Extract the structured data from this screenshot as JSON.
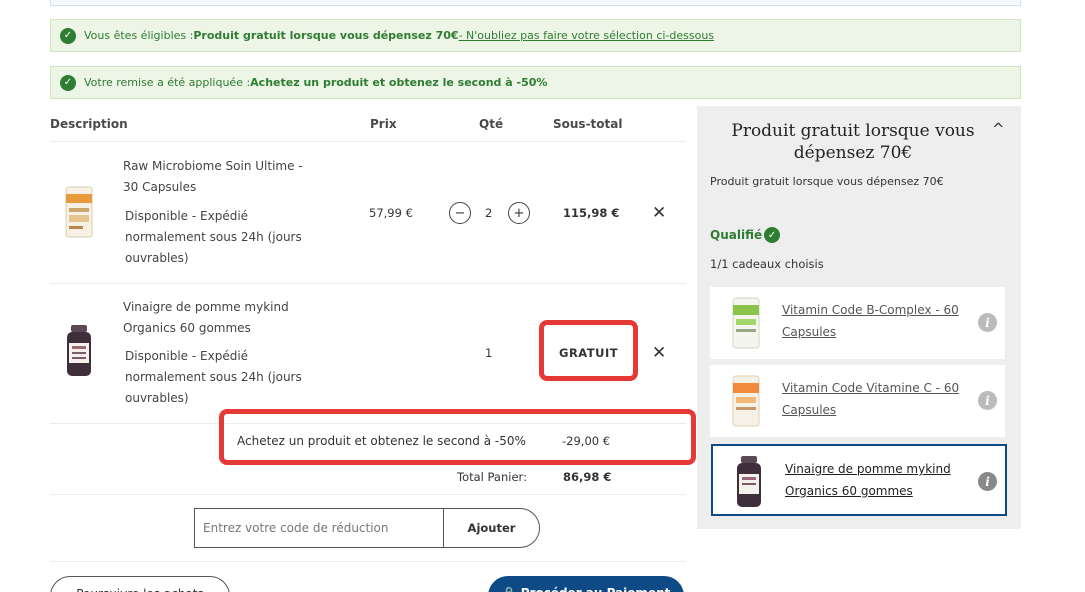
{
  "notices": [
    {
      "prefix": "Vous êtes éligibles : ",
      "bold": "Produit gratuit lorsque vous dépensez 70€",
      "link": " - N'oubliez pas faire votre sélection ci-dessous"
    },
    {
      "prefix": "Votre remise a été appliquée : ",
      "bold": "Achetez un produit et obtenez le second à -50%",
      "link": ""
    }
  ],
  "table": {
    "headers": {
      "description": "Description",
      "price": "Prix",
      "qty": "Qté",
      "subtotal": "Sous-total"
    }
  },
  "items": [
    {
      "name_line1": "Raw Microbiome Soin Ultime -",
      "name_line2": "30 Capsules",
      "avail_line1": "Disponible - Expédié",
      "avail_line2": "normalement sous 24h (jours",
      "avail_line3": "ouvrables)",
      "price": "57,99 €",
      "qty": "2",
      "minus": "−",
      "plus": "+",
      "subtotal": "115,98 €",
      "remove": "✕"
    },
    {
      "name_line1": "Vinaigre de pomme mykind",
      "name_line2": "Organics 60 gommes",
      "avail_line1": "Disponible - Expédié",
      "avail_line2": "normalement sous 24h (jours",
      "avail_line3": "ouvrables)",
      "price": "",
      "qty": "1",
      "subtotal": "GRATUIT",
      "remove": "✕"
    }
  ],
  "discount": {
    "label": "Achetez un produit et obtenez le second à -50%",
    "amount": "-29,00 €"
  },
  "total": {
    "label": "Total Panier:",
    "amount": "86,98 €"
  },
  "promo": {
    "placeholder": "Entrez votre code de réduction",
    "button": "Ajouter"
  },
  "bottom_buttons": {
    "continue": "Poursuivre les achats",
    "checkout": "🔒 Procéder au Paiement"
  },
  "panel": {
    "title": "Produit gratuit lorsque vous dépensez 70€",
    "chevron": "^",
    "subtitle": "Produit gratuit lorsque vous dépensez 70€",
    "qualified": "Qualifié",
    "count": "1/1 cadeaux choisis",
    "gifts": [
      {
        "line1": "Vitamin Code B-Complex - 60",
        "line2": "Capsules",
        "info": "i"
      },
      {
        "line1": "Vitamin Code Vitamine C - 60",
        "line2": "Capsules",
        "info": "i"
      },
      {
        "line1": "Vinaigre de pomme mykind",
        "line2": "Organics 60 gommes",
        "info": "i"
      }
    ]
  },
  "colors": {
    "success": "#2e7d32",
    "highlight": "#e53935",
    "primary": "#0d4a86",
    "panel_bg": "#eeeeee"
  },
  "icons": {
    "check": "✓"
  }
}
